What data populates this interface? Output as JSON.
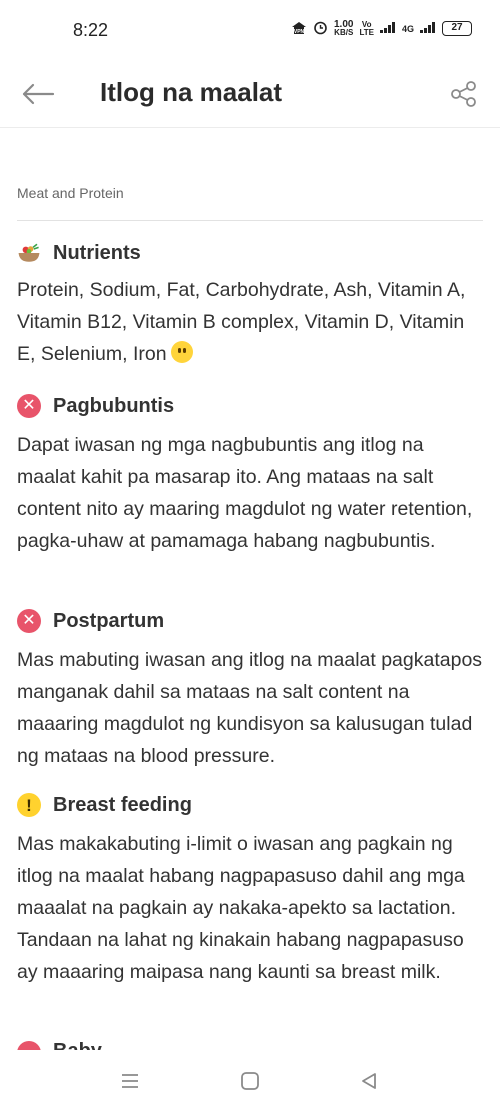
{
  "status_bar": {
    "time": "8:22",
    "speed_value": "1.00",
    "speed_unit": "KB/S",
    "lte_top": "Vo",
    "lte_bottom": "LTE",
    "net_type": "4G",
    "battery": "27"
  },
  "header": {
    "title": "Itlog na maalat",
    "back_icon": "arrow-left-icon",
    "share_icon": "share-icon"
  },
  "category": "Meat and Protein",
  "nutrients": {
    "title": "Nutrients",
    "icon": "food-bowl-icon",
    "text": "Protein, Sodium, Fat, Carbohydrate, Ash, Vitamin A, Vitamin B12, Vitamin B complex, Vitamin D, Vitamin E, Selenium, Iron"
  },
  "sections": [
    {
      "title": "Pagbubuntis",
      "status": "not-recommended",
      "text": "Dapat iwasan ng mga nagbubuntis ang itlog na maalat kahit pa masarap ito. Ang mataas na salt content nito ay maaring magdulot ng water retention, pagka-uhaw at pamamaga habang nagbubuntis."
    },
    {
      "title": "Postpartum",
      "status": "not-recommended",
      "text": "Mas mabuting iwasan ang itlog na maalat pagkatapos manganak dahil sa mataas na salt content na maaaring magdulot ng kundisyon sa kalusugan tulad ng mataas na blood pressure."
    },
    {
      "title": "Breast feeding",
      "status": "caution",
      "text": "Mas makakabuting i-limit o iwasan ang pagkain ng itlog na maalat habang nagpapasuso dahil ang mga maaalat na pagkain ay nakaka-apekto sa lactation. Tandaan na lahat ng kinakain habang nagpapasuso ay maaaring maipasa nang kaunti sa breast milk."
    },
    {
      "title": "Baby",
      "status": "not-recommended"
    }
  ],
  "colors": {
    "not_recommended": "#e8546a",
    "caution": "#ffd22e",
    "icon_gray": "#8a8a8a"
  },
  "nav_bar": {
    "icons": [
      "menu-icon",
      "home-icon",
      "back-triangle-icon"
    ]
  }
}
